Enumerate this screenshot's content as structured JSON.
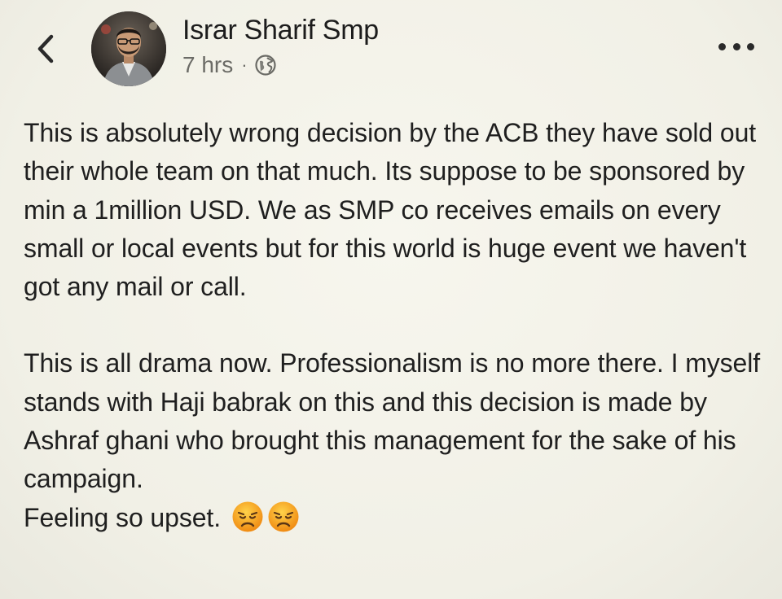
{
  "post": {
    "author_name": "Israr Sharif Smp",
    "time": "7 hrs",
    "separator": "·",
    "privacy_icon": "globe-icon",
    "paragraphs": [
      "This is absolutely wrong decision by the ACB they have sold out their whole team on that much. Its suppose to be sponsored by min a 1million USD. We as SMP co receives emails on every small or local events but for this world is huge event we haven't got any mail or call.",
      "This is all drama now. Professionalism is no more there. I myself stands with Haji babrak on this and this decision is made by Ashraf ghani who brought this management for the sake of his campaign.",
      "Feeling so upset."
    ],
    "emojis": [
      "disappointed-face-emoji",
      "disappointed-face-emoji"
    ]
  },
  "nav": {
    "back_icon": "chevron-left-icon",
    "more_icon": "more-horizontal-icon"
  },
  "colors": {
    "background": "#f4f3ea",
    "text": "#1f1f1f",
    "meta_text": "#6b6b66",
    "emoji": "#f6a21a"
  }
}
